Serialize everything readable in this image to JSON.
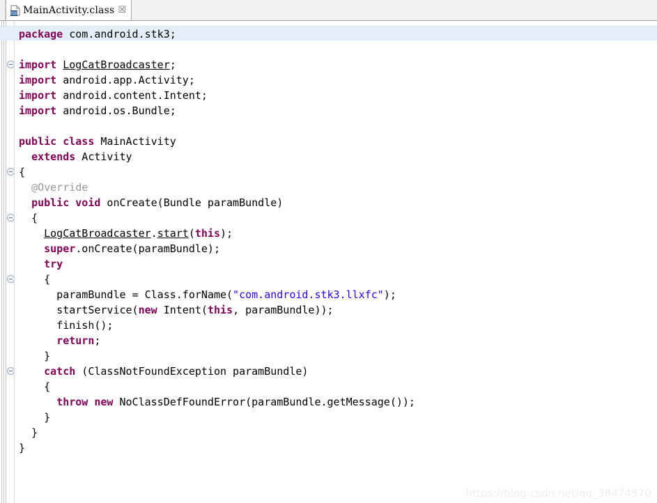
{
  "window": {
    "title": "MainActivity.class"
  },
  "tabbar": {
    "tabs": [
      {
        "label": "MainActivity.class",
        "icon": "class-file-icon",
        "close_glyph": "☒",
        "active": true
      }
    ]
  },
  "editor": {
    "language": "java",
    "current_line": 1,
    "colors": {
      "keyword": "#7f0055",
      "string": "#2a00ff",
      "annotation": "#999999",
      "plain": "#000000",
      "current_line_highlight": "#e4eef9",
      "background": "#ffffff",
      "gutter_separator": "#d9d9d9",
      "fold_marker": "#8fa8c4"
    },
    "fold_markers_on_lines": [
      3,
      10,
      13,
      17,
      23
    ],
    "lines": [
      {
        "n": 1,
        "tokens": [
          {
            "t": "kw",
            "v": "package"
          },
          {
            "t": "pl",
            "v": " com.android.stk3;"
          }
        ]
      },
      {
        "n": 2,
        "tokens": []
      },
      {
        "n": 3,
        "tokens": [
          {
            "t": "kw",
            "v": "import"
          },
          {
            "t": "pl",
            "v": " "
          },
          {
            "t": "und",
            "v": "LogCatBroadcaster"
          },
          {
            "t": "pl",
            "v": ";"
          }
        ]
      },
      {
        "n": 4,
        "tokens": [
          {
            "t": "kw",
            "v": "import"
          },
          {
            "t": "pl",
            "v": " android.app.Activity;"
          }
        ]
      },
      {
        "n": 5,
        "tokens": [
          {
            "t": "kw",
            "v": "import"
          },
          {
            "t": "pl",
            "v": " android.content.Intent;"
          }
        ]
      },
      {
        "n": 6,
        "tokens": [
          {
            "t": "kw",
            "v": "import"
          },
          {
            "t": "pl",
            "v": " android.os.Bundle;"
          }
        ]
      },
      {
        "n": 7,
        "tokens": []
      },
      {
        "n": 8,
        "tokens": [
          {
            "t": "kw",
            "v": "public class"
          },
          {
            "t": "pl",
            "v": " MainActivity"
          }
        ]
      },
      {
        "n": 9,
        "tokens": [
          {
            "t": "pl",
            "v": "  "
          },
          {
            "t": "kw",
            "v": "extends"
          },
          {
            "t": "pl",
            "v": " Activity"
          }
        ]
      },
      {
        "n": 10,
        "tokens": [
          {
            "t": "pl",
            "v": "{"
          }
        ]
      },
      {
        "n": 11,
        "tokens": [
          {
            "t": "pl",
            "v": "  "
          },
          {
            "t": "anno",
            "v": "@Override"
          }
        ]
      },
      {
        "n": 12,
        "tokens": [
          {
            "t": "pl",
            "v": "  "
          },
          {
            "t": "kw",
            "v": "public void"
          },
          {
            "t": "pl",
            "v": " onCreate(Bundle paramBundle)"
          }
        ]
      },
      {
        "n": 13,
        "tokens": [
          {
            "t": "pl",
            "v": "  {"
          }
        ]
      },
      {
        "n": 14,
        "tokens": [
          {
            "t": "pl",
            "v": "    "
          },
          {
            "t": "und",
            "v": "LogCatBroadcaster"
          },
          {
            "t": "pl",
            "v": "."
          },
          {
            "t": "und",
            "v": "start"
          },
          {
            "t": "pl",
            "v": "("
          },
          {
            "t": "kw",
            "v": "this"
          },
          {
            "t": "pl",
            "v": ");"
          }
        ]
      },
      {
        "n": 15,
        "tokens": [
          {
            "t": "pl",
            "v": "    "
          },
          {
            "t": "kw",
            "v": "super"
          },
          {
            "t": "pl",
            "v": ".onCreate(paramBundle);"
          }
        ]
      },
      {
        "n": 16,
        "tokens": [
          {
            "t": "pl",
            "v": "    "
          },
          {
            "t": "kw",
            "v": "try"
          }
        ]
      },
      {
        "n": 17,
        "tokens": [
          {
            "t": "pl",
            "v": "    {"
          }
        ]
      },
      {
        "n": 18,
        "tokens": [
          {
            "t": "pl",
            "v": "      paramBundle = Class.forName("
          },
          {
            "t": "str",
            "v": "\"com.android.stk3.llxfc\""
          },
          {
            "t": "pl",
            "v": ");"
          }
        ]
      },
      {
        "n": 19,
        "tokens": [
          {
            "t": "pl",
            "v": "      startService("
          },
          {
            "t": "kw",
            "v": "new"
          },
          {
            "t": "pl",
            "v": " Intent("
          },
          {
            "t": "kw",
            "v": "this"
          },
          {
            "t": "pl",
            "v": ", paramBundle));"
          }
        ]
      },
      {
        "n": 20,
        "tokens": [
          {
            "t": "pl",
            "v": "      finish();"
          }
        ]
      },
      {
        "n": 21,
        "tokens": [
          {
            "t": "pl",
            "v": "      "
          },
          {
            "t": "kw",
            "v": "return"
          },
          {
            "t": "pl",
            "v": ";"
          }
        ]
      },
      {
        "n": 22,
        "tokens": [
          {
            "t": "pl",
            "v": "    }"
          }
        ]
      },
      {
        "n": 23,
        "tokens": [
          {
            "t": "pl",
            "v": "    "
          },
          {
            "t": "kw",
            "v": "catch"
          },
          {
            "t": "pl",
            "v": " (ClassNotFoundException paramBundle)"
          }
        ]
      },
      {
        "n": 24,
        "tokens": [
          {
            "t": "pl",
            "v": "    {"
          }
        ]
      },
      {
        "n": 25,
        "tokens": [
          {
            "t": "pl",
            "v": "      "
          },
          {
            "t": "kw",
            "v": "throw new"
          },
          {
            "t": "pl",
            "v": " NoClassDefFoundError(paramBundle.getMessage());"
          }
        ]
      },
      {
        "n": 26,
        "tokens": [
          {
            "t": "pl",
            "v": "    }"
          }
        ]
      },
      {
        "n": 27,
        "tokens": [
          {
            "t": "pl",
            "v": "  }"
          }
        ]
      },
      {
        "n": 28,
        "tokens": [
          {
            "t": "pl",
            "v": "}"
          }
        ]
      }
    ]
  },
  "watermark": {
    "text": "https://blog.csdn.net/qq_38474570"
  }
}
